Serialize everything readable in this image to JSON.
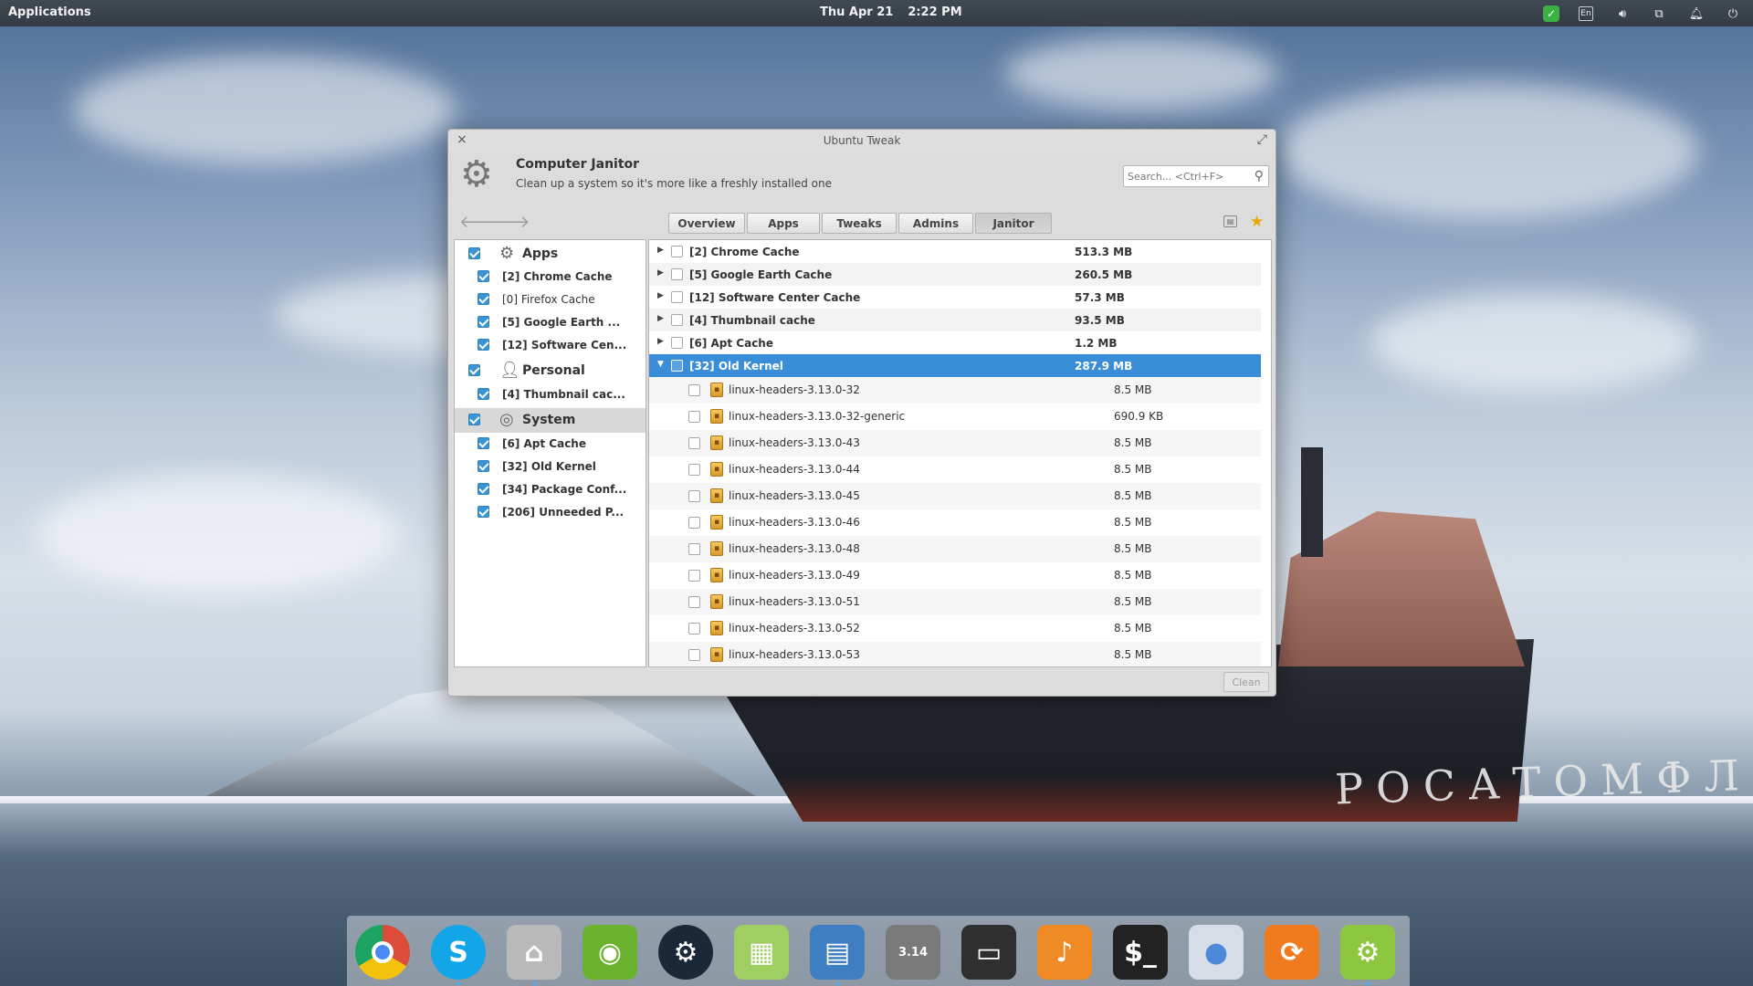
{
  "top_panel": {
    "applications_label": "Applications",
    "date": "Thu Apr 21",
    "time": "2:22 PM",
    "tray": {
      "lang_label": "En",
      "icons": [
        "check-icon",
        "keyboard-layout-icon",
        "volume-icon",
        "network-icon",
        "bell-icon",
        "power-icon"
      ]
    }
  },
  "window": {
    "title": "Ubuntu Tweak",
    "header": {
      "module_title": "Computer Janitor",
      "module_desc": "Clean up a system so it's more like a freshly installed one"
    },
    "search": {
      "placeholder": "Search... <Ctrl+F>",
      "value": ""
    },
    "tabs": [
      {
        "label": "Overview",
        "active": false
      },
      {
        "label": "Apps",
        "active": false
      },
      {
        "label": "Tweaks",
        "active": false
      },
      {
        "label": "Admins",
        "active": false
      },
      {
        "label": "Janitor",
        "active": true
      }
    ],
    "left_pane": {
      "categories": [
        {
          "label": "Apps",
          "icon": "apps-gear-icon",
          "checked": true,
          "items": [
            {
              "label": "[2] Chrome Cache",
              "checked": true
            },
            {
              "label": "[0] Firefox Cache",
              "checked": true
            },
            {
              "label": "[5] Google Earth ...",
              "checked": true
            },
            {
              "label": "[12] Software Cen...",
              "checked": true
            }
          ]
        },
        {
          "label": "Personal",
          "icon": "person-icon",
          "checked": true,
          "items": [
            {
              "label": "[4] Thumbnail cac...",
              "checked": true
            }
          ]
        },
        {
          "label": "System",
          "icon": "ubuntu-logo-icon",
          "checked": true,
          "selected": true,
          "items": [
            {
              "label": "[6] Apt Cache",
              "checked": true
            },
            {
              "label": "[32] Old Kernel",
              "checked": true
            },
            {
              "label": "[34] Package Conf...",
              "checked": true
            },
            {
              "label": "[206] Unneeded P...",
              "checked": true
            }
          ]
        }
      ]
    },
    "right_pane": {
      "groups": [
        {
          "name": "[2] Chrome Cache",
          "size": "513.3 MB",
          "expanded": false
        },
        {
          "name": "[5] Google Earth Cache",
          "size": "260.5 MB",
          "expanded": false
        },
        {
          "name": "[12] Software Center Cache",
          "size": "57.3 MB",
          "expanded": false
        },
        {
          "name": "[4] Thumbnail cache",
          "size": "93.5 MB",
          "expanded": false
        },
        {
          "name": "[6] Apt Cache",
          "size": "1.2 MB",
          "expanded": false
        },
        {
          "name": "[32] Old Kernel",
          "size": "287.9 MB",
          "expanded": true,
          "selected": true
        }
      ],
      "kernel_items": [
        {
          "name": "linux-headers-3.13.0-32",
          "size": "8.5 MB"
        },
        {
          "name": "linux-headers-3.13.0-32-generic",
          "size": "690.9 KB"
        },
        {
          "name": "linux-headers-3.13.0-43",
          "size": "8.5 MB"
        },
        {
          "name": "linux-headers-3.13.0-44",
          "size": "8.5 MB"
        },
        {
          "name": "linux-headers-3.13.0-45",
          "size": "8.5 MB"
        },
        {
          "name": "linux-headers-3.13.0-46",
          "size": "8.5 MB"
        },
        {
          "name": "linux-headers-3.13.0-48",
          "size": "8.5 MB"
        },
        {
          "name": "linux-headers-3.13.0-49",
          "size": "8.5 MB"
        },
        {
          "name": "linux-headers-3.13.0-51",
          "size": "8.5 MB"
        },
        {
          "name": "linux-headers-3.13.0-52",
          "size": "8.5 MB"
        },
        {
          "name": "linux-headers-3.13.0-53",
          "size": "8.5 MB"
        }
      ]
    },
    "clean_label": "Clean"
  },
  "dock": {
    "items": [
      {
        "name": "chrome",
        "glyph": "",
        "color": "#dd4b39"
      },
      {
        "name": "skype",
        "glyph": "S",
        "color": "#12a5e8"
      },
      {
        "name": "files",
        "glyph": "⌂",
        "color": "#b9b9b9"
      },
      {
        "name": "nvidia-settings",
        "glyph": "◉",
        "color": "#6bb32e"
      },
      {
        "name": "steam",
        "glyph": "⚙",
        "color": "#1b2838"
      },
      {
        "name": "spreadsheet",
        "glyph": "▦",
        "color": "#9fcf62"
      },
      {
        "name": "document-writer",
        "glyph": "▤",
        "color": "#3f7fc1"
      },
      {
        "name": "calculator",
        "glyph": "3.14",
        "color": "#7a7a7a"
      },
      {
        "name": "screenshot",
        "glyph": "▭",
        "color": "#2f2f2f"
      },
      {
        "name": "music",
        "glyph": "♪",
        "color": "#f08a24"
      },
      {
        "name": "terminal",
        "glyph": "$_",
        "color": "#222222"
      },
      {
        "name": "system-settings",
        "glyph": "●",
        "color": "#d6dde6"
      },
      {
        "name": "software-updater",
        "glyph": "⟳",
        "color": "#f07a1e"
      },
      {
        "name": "ubuntu-tweak",
        "glyph": "⚙",
        "color": "#8dc63f"
      }
    ]
  }
}
